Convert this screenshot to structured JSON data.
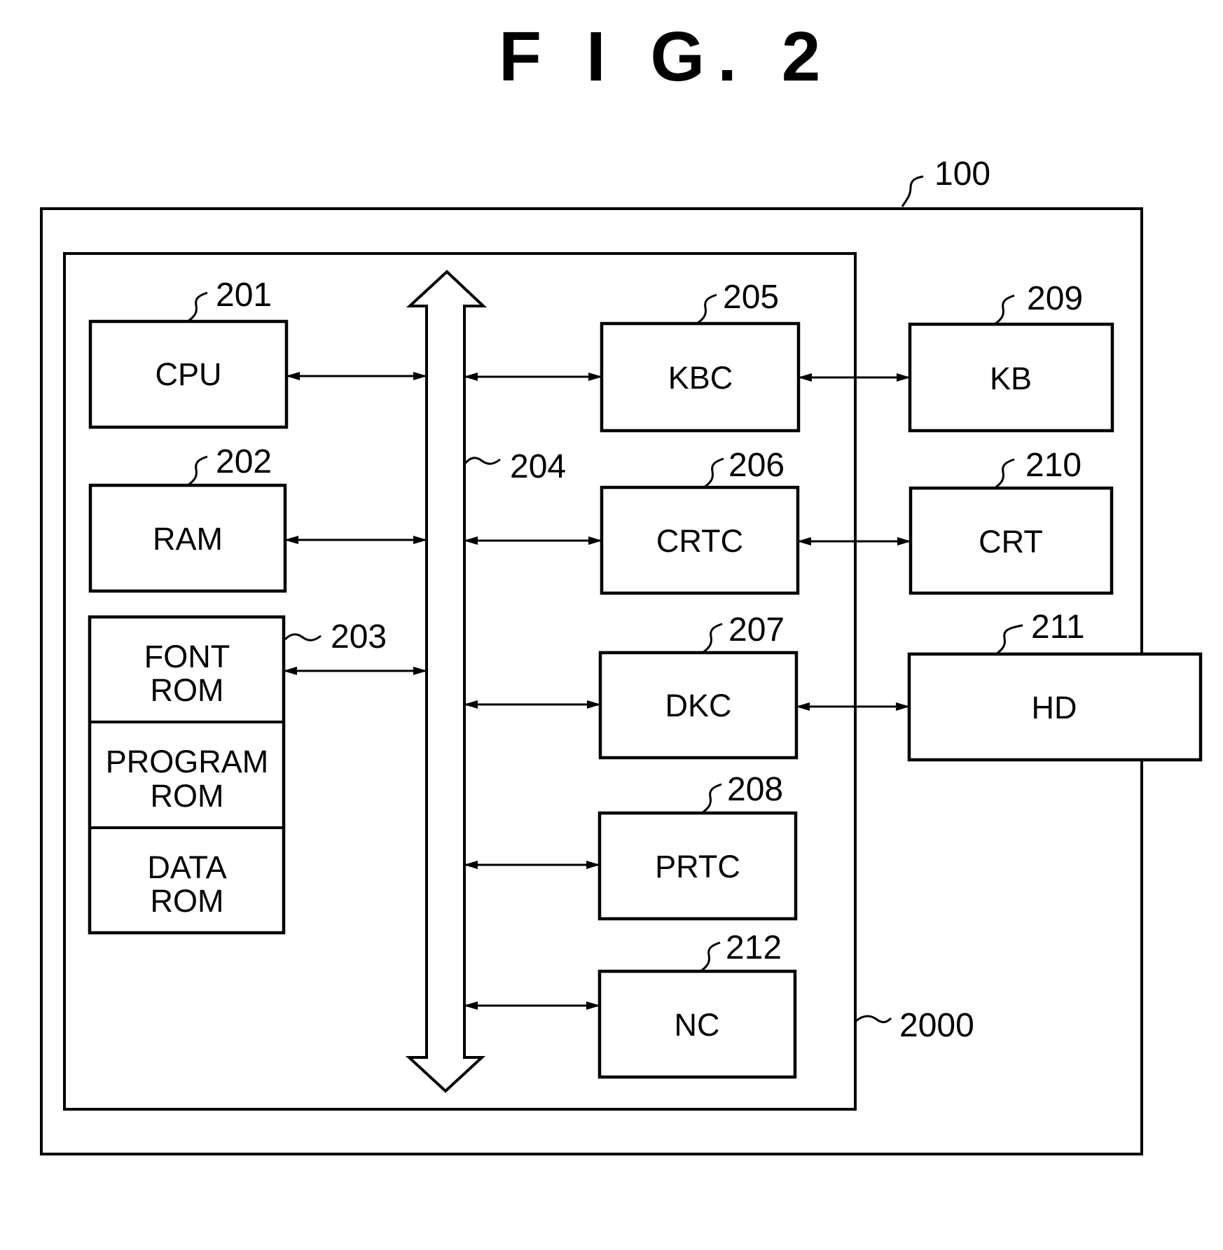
{
  "figure": {
    "title": "F I G. 2"
  },
  "labels": {
    "system": "100",
    "computer": "2000",
    "bus": "204",
    "cpu": "201",
    "ram": "202",
    "rom": "203",
    "kbc": "205",
    "crtc": "206",
    "dkc": "207",
    "prtc": "208",
    "kb": "209",
    "crt": "210",
    "hd": "211",
    "nc": "212"
  },
  "blocks": {
    "cpu": "CPU",
    "ram": "RAM",
    "font_rom": [
      "FONT",
      "ROM"
    ],
    "program_rom": [
      "PROGRAM",
      "ROM"
    ],
    "data_rom": [
      "DATA",
      "ROM"
    ],
    "kbc": "KBC",
    "crtc": "CRTC",
    "dkc": "DKC",
    "prtc": "PRTC",
    "nc": "NC",
    "kb": "KB",
    "crt": "CRT",
    "hd": "HD"
  }
}
